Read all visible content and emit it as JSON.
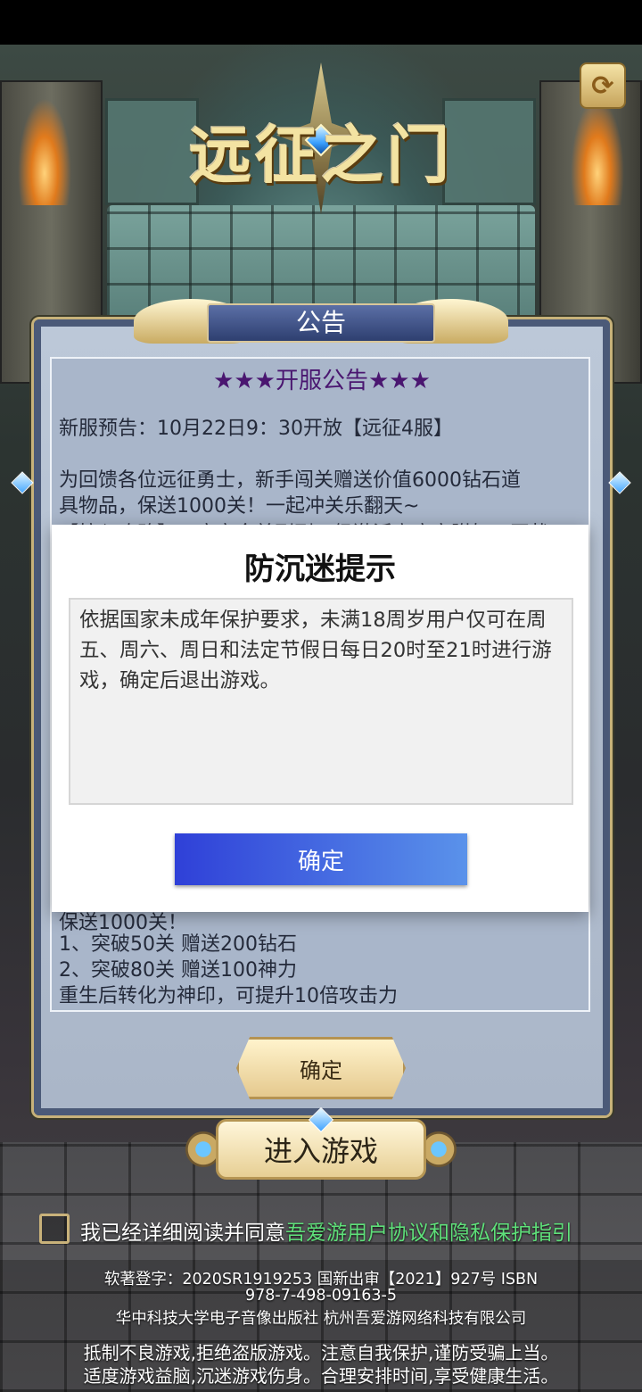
{
  "game": {
    "title": "远征之门"
  },
  "notice": {
    "header": "公告",
    "headline": "★★★开服公告★★★",
    "line1": "新服预告：10月22日9：30开放【远征4服】",
    "line2a": "为回馈各位远征勇士，新手闯关赠送价值6000钻石道",
    "line2b": "具物品，保送1000关！一起冲关乐翻天~",
    "line3_partial": "【拉入攻略】…度完全首到到…级激活高度实附如…同状",
    "line4_partial": "保送1000关！",
    "line5": "1、突破50关 赠送200钻石",
    "line6": "2、突破80关 赠送100神力",
    "line7": "重生后转化为神印，可提升10倍攻击力",
    "confirm_label": "确定"
  },
  "modal": {
    "title": "防沉迷提示",
    "body": "依据国家未成年保护要求，未满18周岁用户仅可在周五、周六、周日和法定节假日每日20时至21时进行游戏，确定后退出游戏。",
    "confirm_label": "确定"
  },
  "enter": {
    "label": "进入游戏"
  },
  "agreement": {
    "prefix": "我已经详细阅读并同意",
    "link": "吾爱游用户协议和隐私保护指引",
    "checked": false
  },
  "footer": {
    "line1": "软著登字：2020SR1919253     国新出审【2021】927号     ISBN",
    "line2": "978-7-498-09163-5",
    "line3": "华中科技大学电子音像出版社      杭州吾爱游网络科技有限公司",
    "line4": "抵制不良游戏,拒绝盗版游戏。注意自我保护,谨防受骗上当。",
    "line5": "适度游戏益脑,沉迷游戏伤身。合理安排时间,享受健康生活。"
  },
  "icons": {
    "corner": "refresh-icon",
    "checkbox": "checkbox-icon"
  },
  "colors": {
    "modal_button_start": "#2f40d8",
    "modal_button_end": "#5a92ea",
    "agreement_link": "#5fe07a",
    "headline": "#4a1670"
  }
}
